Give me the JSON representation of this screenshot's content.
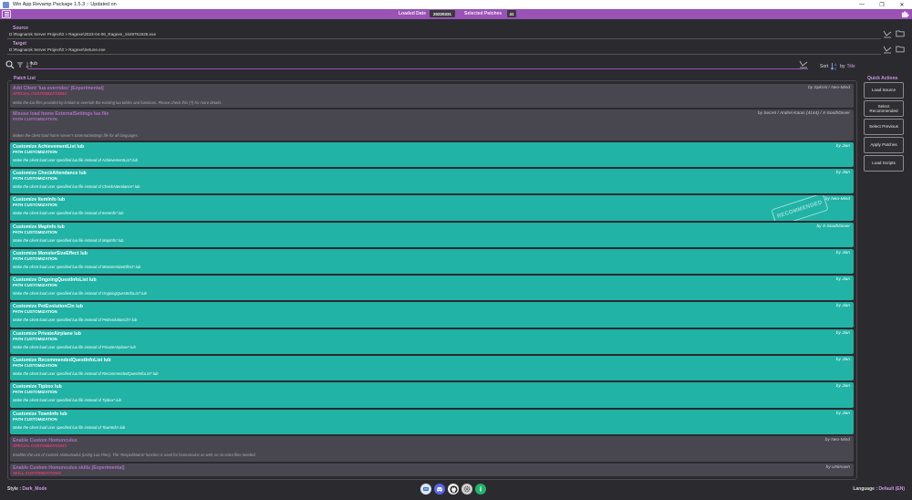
{
  "window": {
    "title": "Win App Revamp Package 1.5.3 :: Updated on",
    "minimize": "—",
    "maximize": "❐",
    "close": "✕"
  },
  "header": {
    "loaded_date_label": "Loaded Date",
    "loaded_date_value": "20220331",
    "selected_patches_label": "Selected Patches",
    "selected_patches_value": "41"
  },
  "source": {
    "label": "Source",
    "value": "D:\\Ragnarok Server Project\\0 > Ragexe\\2023-04-06_Ragexe_1649761926.exe"
  },
  "target": {
    "label": "Target",
    "value": "D:\\Ragnarok Server Project\\0 > Ragexe\\Setune.exe"
  },
  "search": {
    "value": "lub"
  },
  "sort": {
    "label": "Sort",
    "by": "by",
    "field": "Title"
  },
  "patch_list": {
    "legend": "Patch List",
    "stamp": "RECOMMENDED",
    "items": [
      {
        "title": "Add Client 'lua overrides' [Experimental]",
        "category": "SPECIAL CUSTOMIZATIONS",
        "desc": "Make the lua files provided by lcmlab to override the existing lua tables and functions. Please check this (?) for more details.",
        "author": "by Spkrist / Neo-Mind",
        "style": "dark"
      },
      {
        "title": "Misuse load home ExternalSettings lua file",
        "category": "PATH CUSTOMIZATION",
        "desc": "Makes the client load home server's ExternalSettings file for all languages.",
        "author": "by Secret / Andrei Karas (4144) / X-SouthDover",
        "style": "dark-path"
      },
      {
        "title": "Customize AchievementList lub",
        "category": "PATH CUSTOMIZATION",
        "desc": "Make the client load user specified lua file instead of AchievementList*.lub",
        "author": "by Jian",
        "style": "teal"
      },
      {
        "title": "Customize CheckAttendance lub",
        "category": "PATH CUSTOMIZATION",
        "desc": "Make the client load user specified lua file instead of CheckAttendance*.lub",
        "author": "by Jian",
        "style": "teal"
      },
      {
        "title": "Customize ItemInfo lub",
        "category": "PATH CUSTOMIZATION",
        "desc": "Make the client load user specified lua file instead of ItemInfo*.lub",
        "author": "by Neo-Mind",
        "style": "teal",
        "stamp": true
      },
      {
        "title": "Customize MapInfo lub",
        "category": "PATH CUSTOMIZATION",
        "desc": "Make the client load user specified lua file instead of MapInfo*.lub",
        "author": "by X-SouthDover",
        "style": "teal"
      },
      {
        "title": "Customize MonsterSizeEffect lub",
        "category": "PATH CUSTOMIZATION",
        "desc": "Make the client load user specified lua file instead of MonsterSizeEffect*.lub",
        "author": "by Jian",
        "style": "teal"
      },
      {
        "title": "Customize OngoingQuestInfoList lub",
        "category": "PATH CUSTOMIZATION",
        "desc": "Make the client load user specified lua file instead of OngoingQuestInfoList*.lub",
        "author": "by Jian",
        "style": "teal"
      },
      {
        "title": "Customize PetEvolutionCln lub",
        "category": "PATH CUSTOMIZATION",
        "desc": "Make the client load user specified lua file instead of PetEvolutionCln*.lub",
        "author": "by Jian",
        "style": "teal"
      },
      {
        "title": "Customize PrivateAirplane lub",
        "category": "PATH CUSTOMIZATION",
        "desc": "Make the client load user specified lua file instead of PrivateAirplane*.lub",
        "author": "by Jian",
        "style": "teal"
      },
      {
        "title": "Customize RecommendedQuestInfoList lub",
        "category": "PATH CUSTOMIZATION",
        "desc": "Make the client load user specified lua file instead of RecommendedQuestInfoList*.lub",
        "author": "by Jian",
        "style": "teal"
      },
      {
        "title": "Customize Tipbox lub",
        "category": "PATH CUSTOMIZATION",
        "desc": "Make the client load user specified lua file instead of Tipbox*.lub",
        "author": "by Jian",
        "style": "teal"
      },
      {
        "title": "Customize TownInfo lub",
        "category": "PATH CUSTOMIZATION",
        "desc": "Make the client load user specified lua file instead of TownInfo*.lub",
        "author": "by Jian",
        "style": "teal"
      },
      {
        "title": "Enable Custom Homunculus",
        "category": "SPECIAL CUSTOMIZATIONS",
        "desc": "Enables the use of Custom Homunculus (using Lua Files). The 'ReqJobName' function is used for homunculus as well, so no extra files needed.",
        "author": "by Neo-Mind",
        "style": "dark"
      },
      {
        "title": "Enable Custom Homunculus skills [Experimental]",
        "category": "SKILL CUSTOMIZATIONS",
        "desc": "",
        "author": "by Unknown",
        "style": "dark"
      }
    ]
  },
  "quick_actions": {
    "title": "Quick Actions",
    "buttons": [
      "Load Source",
      "Select Recommended",
      "Select Previous",
      "Apply Patches",
      "Load Scripts"
    ]
  },
  "footer": {
    "style_label": "Style :",
    "style_value": "Dark_Mode",
    "language_label": "Language :",
    "language_value": "Default (EN)"
  },
  "colors": {
    "accent": "#9a52b6",
    "teal": "#20b3a6",
    "card_dark": "#48474f",
    "special_category": "#e03a7d"
  }
}
